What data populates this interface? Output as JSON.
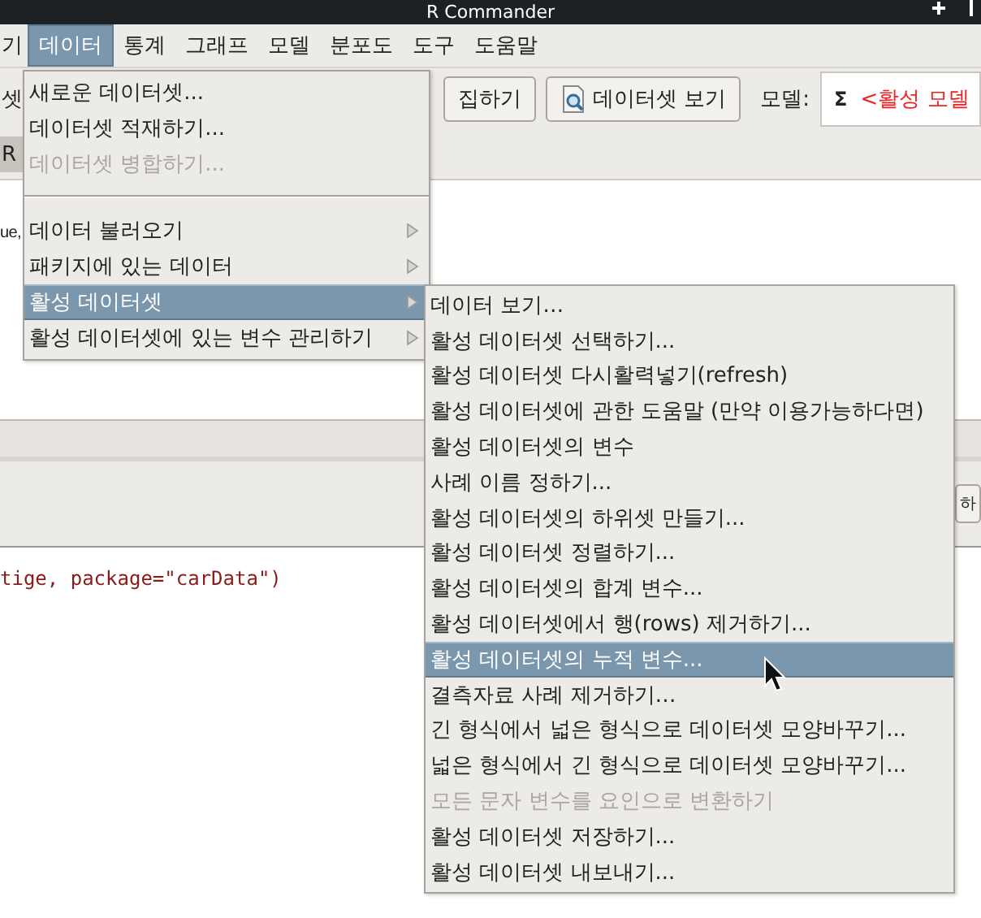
{
  "window": {
    "title": "R Commander"
  },
  "menubar": [
    {
      "label": "기",
      "selected": false
    },
    {
      "label": "데이터",
      "selected": true
    },
    {
      "label": "통계",
      "selected": false
    },
    {
      "label": "그래프",
      "selected": false
    },
    {
      "label": "모델",
      "selected": false
    },
    {
      "label": "분포도",
      "selected": false
    },
    {
      "label": "도구",
      "selected": false
    },
    {
      "label": "도움말",
      "selected": false
    }
  ],
  "toolbar": {
    "left_text": "셋",
    "edit_button": "집하기",
    "view_button": "데이터셋 보기",
    "model_label": "모델:",
    "model_icon": "Σ",
    "model_value": "<활성 모델"
  },
  "tab_text": "R",
  "script_text": "ue,",
  "submit_button": "하",
  "output_text": "tige, package=\"carData\")",
  "data_menu": [
    {
      "kind": "item",
      "label": "새로운 데이터셋...",
      "disabled": false,
      "submenu": false,
      "selected": false
    },
    {
      "kind": "item",
      "label": "데이터셋 적재하기...",
      "disabled": false,
      "submenu": false,
      "selected": false
    },
    {
      "kind": "item",
      "label": "데이터셋 병합하기...",
      "disabled": true,
      "submenu": false,
      "selected": false
    },
    {
      "kind": "separator"
    },
    {
      "kind": "item",
      "label": "데이터 불러오기",
      "disabled": false,
      "submenu": true,
      "selected": false
    },
    {
      "kind": "item",
      "label": "패키지에 있는 데이터",
      "disabled": false,
      "submenu": true,
      "selected": false
    },
    {
      "kind": "item",
      "label": "활성 데이터셋",
      "disabled": false,
      "submenu": true,
      "selected": true
    },
    {
      "kind": "item",
      "label": "활성 데이터셋에 있는 변수 관리하기",
      "disabled": false,
      "submenu": true,
      "selected": false
    }
  ],
  "submenu": [
    {
      "label": "데이터 보기…",
      "disabled": false,
      "selected": false
    },
    {
      "label": "활성 데이터셋 선택하기...",
      "disabled": false,
      "selected": false
    },
    {
      "label": "활성 데이터셋 다시활력넣기(refresh)",
      "disabled": false,
      "selected": false
    },
    {
      "label": "활성 데이터셋에 관한 도움말 (만약 이용가능하다면)",
      "disabled": false,
      "selected": false
    },
    {
      "label": "활성 데이터셋의 변수",
      "disabled": false,
      "selected": false
    },
    {
      "label": "사례 이름 정하기...",
      "disabled": false,
      "selected": false
    },
    {
      "label": "활성 데이터셋의 하위셋 만들기...",
      "disabled": false,
      "selected": false
    },
    {
      "label": "활성 데이터셋 정렬하기...",
      "disabled": false,
      "selected": false
    },
    {
      "label": "활성 데이터셋의 합계 변수...",
      "disabled": false,
      "selected": false
    },
    {
      "label": "활성 데이터셋에서 행(rows) 제거하기...",
      "disabled": false,
      "selected": false
    },
    {
      "label": "활성 데이터셋의 누적 변수...",
      "disabled": false,
      "selected": true
    },
    {
      "label": "결측자료 사례 제거하기…",
      "disabled": false,
      "selected": false
    },
    {
      "label": "긴 형식에서 넓은 형식으로 데이터셋 모양바꾸기...",
      "disabled": false,
      "selected": false
    },
    {
      "label": "넓은 형식에서 긴 형식으로 데이터셋 모양바꾸기...",
      "disabled": false,
      "selected": false
    },
    {
      "label": "모든 문자 변수를 요인으로 변환하기",
      "disabled": true,
      "selected": false
    },
    {
      "label": "활성 데이터셋 저장하기...",
      "disabled": false,
      "selected": false
    },
    {
      "label": "활성 데이터셋 내보내기...",
      "disabled": false,
      "selected": false
    }
  ]
}
